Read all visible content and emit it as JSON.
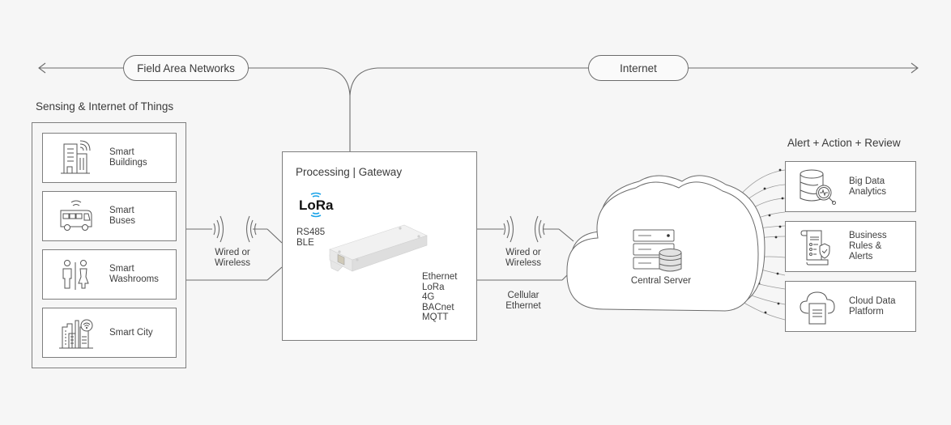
{
  "network_bar": {
    "left_label": "Field Area Networks",
    "right_label": "Internet"
  },
  "iot": {
    "title": "Sensing & Internet of Things",
    "items": [
      {
        "label_line1": "Smart",
        "label_line2": "Buildings",
        "icon": "building-icon"
      },
      {
        "label_line1": "Smart",
        "label_line2": "Buses",
        "icon": "bus-icon"
      },
      {
        "label_line1": "Smart",
        "label_line2": "Washrooms",
        "icon": "washroom-icon"
      },
      {
        "label_line1": "Smart City",
        "label_line2": "",
        "icon": "city-icon"
      }
    ]
  },
  "left_connection": {
    "line1": "Wired or",
    "line2": "Wireless"
  },
  "gateway": {
    "title": "Processing | Gateway",
    "logo_text": "LoRa",
    "inputs": [
      "RS485",
      "BLE"
    ],
    "outputs": [
      "Ethernet",
      "LoRa",
      "4G",
      "BACnet",
      "MQTT"
    ]
  },
  "right_connection": {
    "wireless_line1": "Wired or",
    "wireless_line2": "Wireless",
    "wired_line1": "Cellular",
    "wired_line2": "Ethernet"
  },
  "cloud": {
    "label": "Central Server"
  },
  "outputs": {
    "title": "Alert + Action + Review",
    "items": [
      {
        "line1": "Big Data",
        "line2": "Analytics",
        "line3": "",
        "icon": "analytics-icon"
      },
      {
        "line1": "Business",
        "line2": "Rules &",
        "line3": "Alerts",
        "icon": "rules-icon"
      },
      {
        "line1": "Cloud Data",
        "line2": "Platform",
        "line3": "",
        "icon": "cloud-data-icon"
      }
    ]
  },
  "colors": {
    "background": "#f6f6f6",
    "stroke": "#6c6c6c",
    "lora_blue": "#1aa3e8"
  }
}
